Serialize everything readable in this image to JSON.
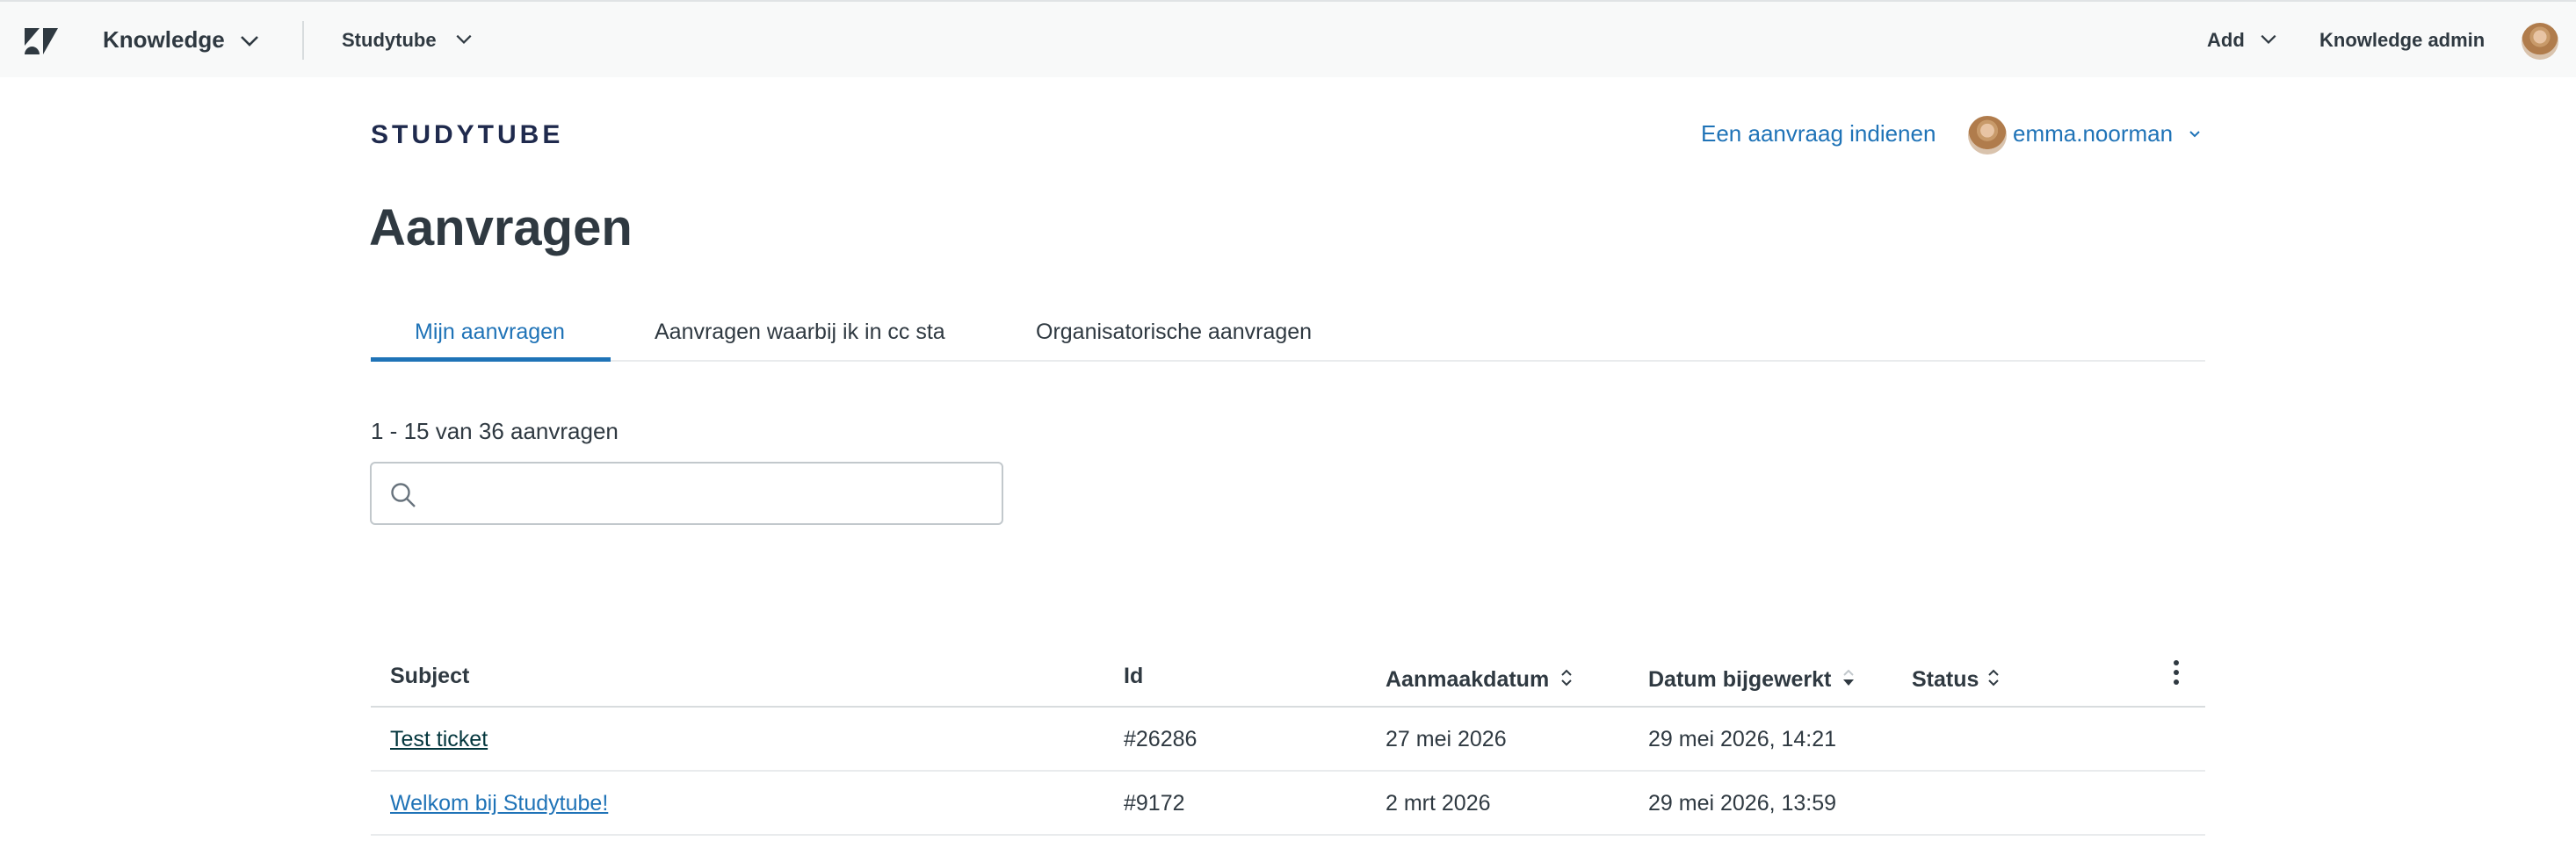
{
  "topbar": {
    "product": "Knowledge",
    "brand": "Studytube",
    "add": "Add",
    "admin": "Knowledge admin"
  },
  "header": {
    "logo_text": "STUDYTUBE",
    "submit_request": "Een aanvraag indienen",
    "username": "emma.noorman"
  },
  "page": {
    "title": "Aanvragen",
    "tabs": [
      {
        "label": "Mijn aanvragen",
        "active": true
      },
      {
        "label": "Aanvragen waarbij ik in cc sta",
        "active": false
      },
      {
        "label": "Organisatorische aanvragen",
        "active": false
      }
    ],
    "count": "1 - 15 van 36 aanvragen",
    "search": {
      "value": "",
      "placeholder": ""
    }
  },
  "table": {
    "columns": [
      "Subject",
      "Id",
      "Aanmaakdatum",
      "Datum bijgewerkt",
      "Status"
    ],
    "rows": [
      {
        "subject": "Test ticket",
        "id": "#26286",
        "created": "27 mei 2026",
        "updated": "29 mei 2026, 14:21",
        "status": ""
      },
      {
        "subject": "Welkom bij Studytube!",
        "id": "#9172",
        "created": "2 mrt 2026",
        "updated": "29 mei 2026, 13:59",
        "status": ""
      }
    ]
  },
  "colors": {
    "link": "#1f73b7",
    "text": "#2f3941",
    "topbar_bg": "#f8f9f9"
  }
}
